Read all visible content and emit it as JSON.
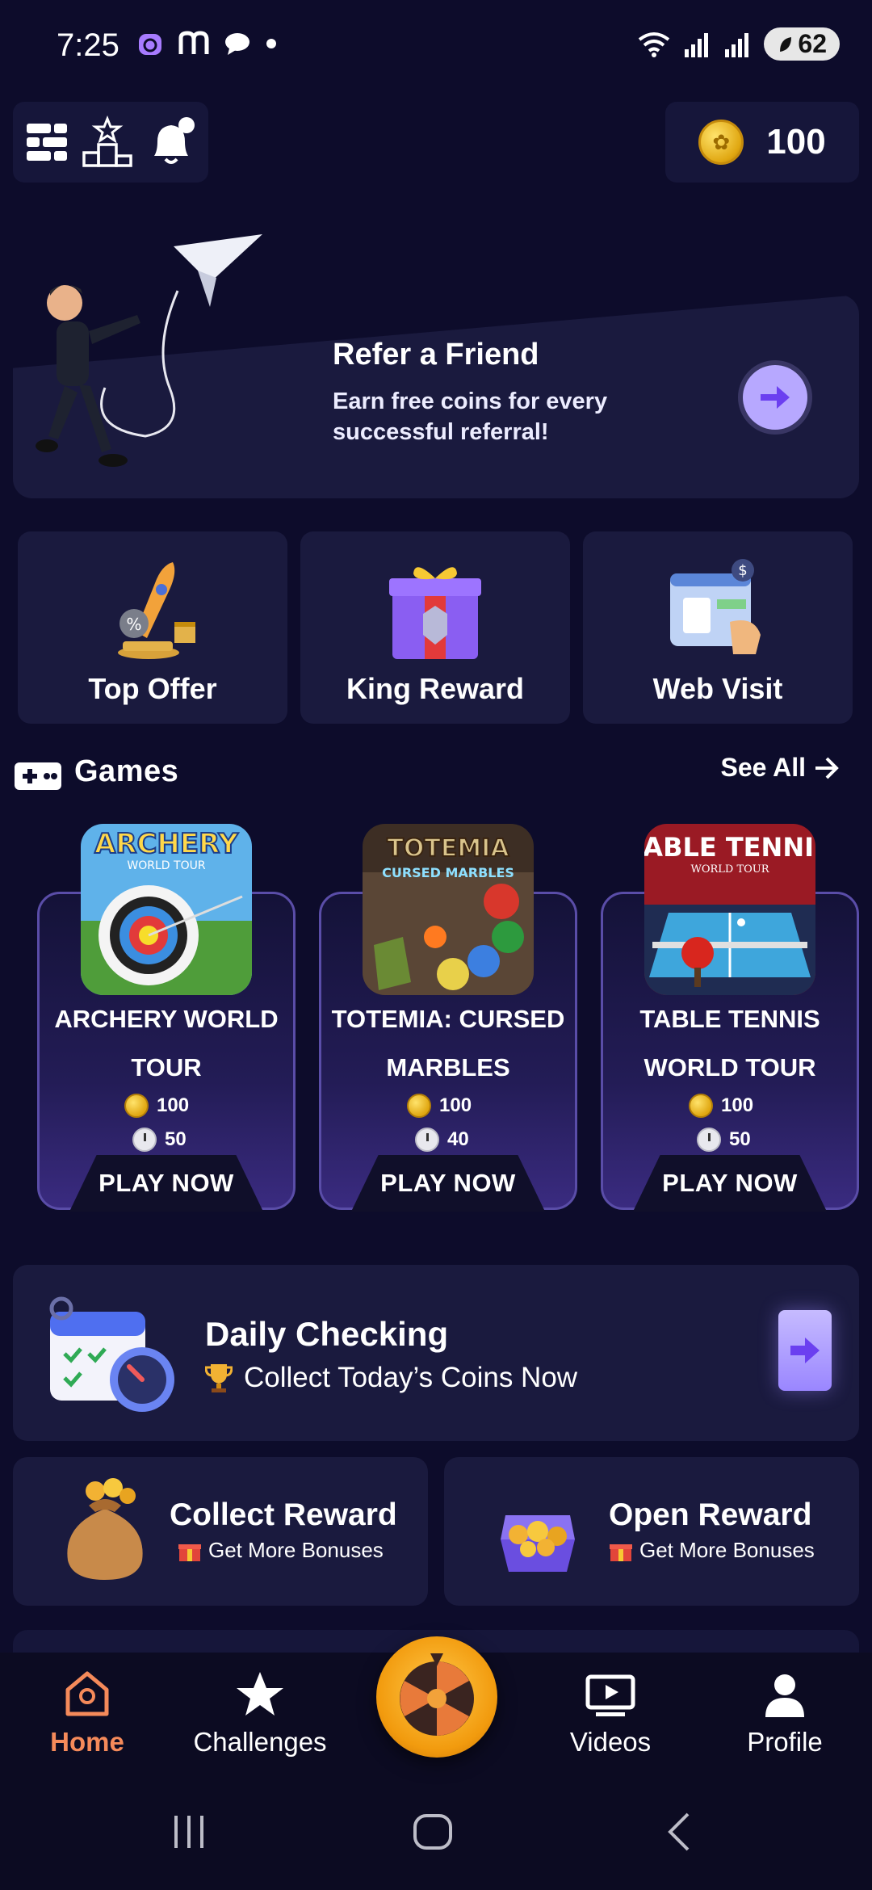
{
  "status_bar": {
    "time": "7:25",
    "battery": "62"
  },
  "header": {
    "coin_balance": "100"
  },
  "refer": {
    "title": "Refer a Friend",
    "subtitle": "Earn free coins for every successful referral!"
  },
  "tiles": [
    {
      "label": "Top Offer"
    },
    {
      "label": "King Reward"
    },
    {
      "label": "Web Visit"
    }
  ],
  "games_section": {
    "title": "Games",
    "see_all": "See All"
  },
  "games": [
    {
      "name": "ARCHERY WORLD TOUR",
      "thumb_text": "ARCHERY",
      "thumb_sub": "WORLD TOUR",
      "coins": "100",
      "time": "50",
      "play": "PLAY NOW"
    },
    {
      "name": "TOTEMIA: CURSED MARBLES",
      "thumb_text": "TOTEMIA",
      "thumb_sub": "CURSED MARBLES",
      "coins": "100",
      "time": "40",
      "play": "PLAY NOW"
    },
    {
      "name": "TABLE TENNIS WORLD TOUR",
      "thumb_text": "TABLE TENNIS",
      "thumb_sub": "WORLD TOUR",
      "coins": "100",
      "time": "50",
      "play": "PLAY NOW"
    }
  ],
  "daily": {
    "title": "Daily Checking",
    "subtitle": "Collect Today’s Coins Now"
  },
  "rewards": [
    {
      "title": "Collect Reward",
      "subtitle": "Get More Bonuses"
    },
    {
      "title": "Open Reward",
      "subtitle": "Get More Bonuses"
    }
  ],
  "nav": {
    "home": "Home",
    "challenges": "Challenges",
    "videos": "Videos",
    "profile": "Profile"
  },
  "colors": {
    "background": "#0d0c2b",
    "card": "#1a1a3e",
    "accent_purple": "#9a86ff",
    "home_active": "#f58a5a",
    "coin_gold": "#e0a711"
  }
}
